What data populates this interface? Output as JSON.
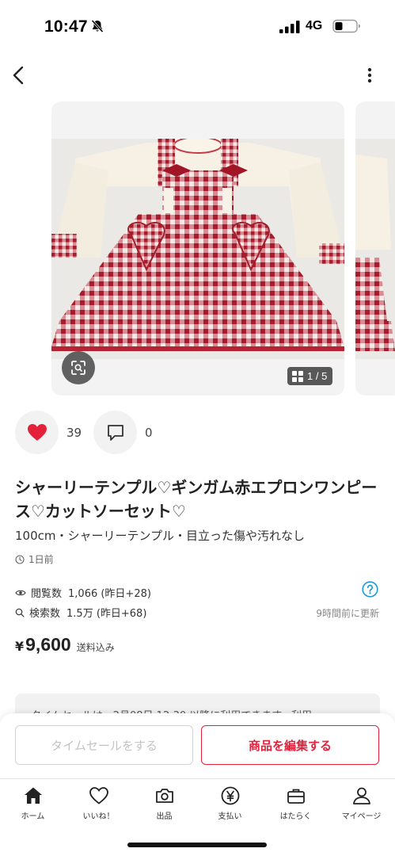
{
  "status_bar": {
    "time": "10:47",
    "network": "4G",
    "icons": [
      "bell-off-icon",
      "signal-icon",
      "battery-icon"
    ]
  },
  "nav": {
    "back_icon": "chevron-left-icon",
    "more_icon": "vertical-dots-icon"
  },
  "gallery": {
    "page_indicator": "1 / 5",
    "icons": [
      "scan-icon",
      "grid-icon"
    ]
  },
  "actions": {
    "likes": "39",
    "comments": "0",
    "like_color": "#e4213b"
  },
  "item": {
    "title": "シャーリーテンプル♡ギンガム赤エプロンワンピース♡カットソーセット♡",
    "subtitle": "100cm・シャーリーテンプル・目立った傷や汚れなし",
    "posted": "1日前"
  },
  "stats": {
    "views_label": "閲覧数",
    "views_value": "1,066 (昨日+28)",
    "search_label": "検索数",
    "search_value": "1.5万 (昨日+68)",
    "updated": "9時間前に更新",
    "help_color": "#1a9bd7"
  },
  "price": {
    "currency": "¥",
    "amount": "9,600",
    "note": "送料込み"
  },
  "notice": {
    "text": "タイムセールは、2月08日 12:30 以降に利用できます。利用"
  },
  "buttons": {
    "time_sale": "タイムセールをする",
    "edit": "商品を編集する",
    "accent": "#e4213b"
  },
  "tabs": [
    {
      "label": "ホーム",
      "icon": "home-icon"
    },
    {
      "label": "いいね！",
      "icon": "heart-outline-icon"
    },
    {
      "label": "出品",
      "icon": "camera-icon"
    },
    {
      "label": "支払い",
      "icon": "yen-icon"
    },
    {
      "label": "はたらく",
      "icon": "briefcase-icon"
    },
    {
      "label": "マイページ",
      "icon": "person-icon"
    }
  ]
}
